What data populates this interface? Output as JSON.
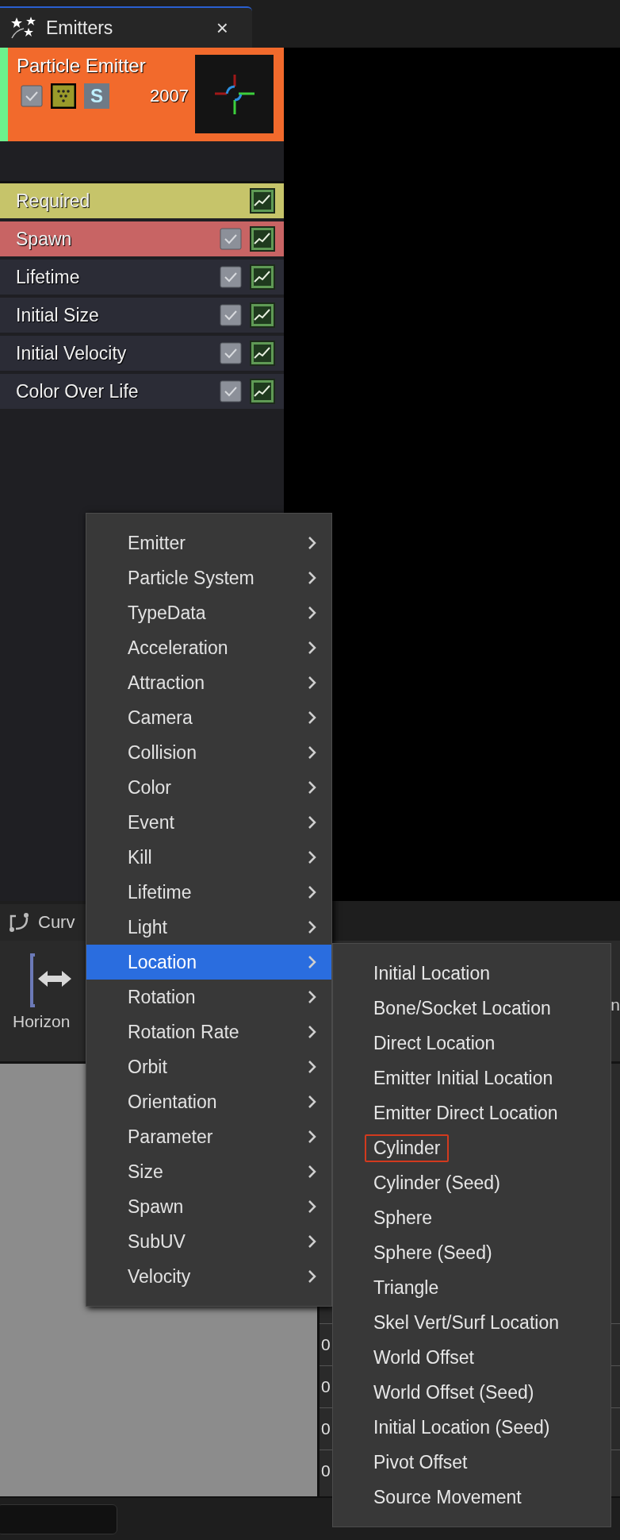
{
  "emitters_tab": {
    "title": "Emitters",
    "close": "×"
  },
  "emitter": {
    "name": "Particle Emitter",
    "enabled": true,
    "solo_label": "S",
    "count": "2007"
  },
  "modules": [
    {
      "label": "Required",
      "kind": "required",
      "color": "#c6c46a"
    },
    {
      "label": "Spawn",
      "kind": "module",
      "color": "#c86464",
      "checked": true
    },
    {
      "label": "Lifetime",
      "kind": "module",
      "color": "#2b2c36",
      "checked": true
    },
    {
      "label": "Initial Size",
      "kind": "module",
      "color": "#2b2c36",
      "checked": true
    },
    {
      "label": "Initial Velocity",
      "kind": "module",
      "color": "#2b2c36",
      "checked": true
    },
    {
      "label": "Color Over Life",
      "kind": "module",
      "color": "#2b2c36",
      "checked": true
    }
  ],
  "curve_editor": {
    "tab_label": "Curv",
    "toolbar_button": "Horizon",
    "toolbar_label_2": "n",
    "values": [
      "0",
      "0",
      "0",
      "0"
    ]
  },
  "context_menu": {
    "items": [
      {
        "label": "Emitter",
        "selected": false
      },
      {
        "label": "Particle System",
        "selected": false
      },
      {
        "label": "TypeData",
        "selected": false
      },
      {
        "label": "Acceleration",
        "selected": false
      },
      {
        "label": "Attraction",
        "selected": false
      },
      {
        "label": "Camera",
        "selected": false
      },
      {
        "label": "Collision",
        "selected": false
      },
      {
        "label": "Color",
        "selected": false
      },
      {
        "label": "Event",
        "selected": false
      },
      {
        "label": "Kill",
        "selected": false
      },
      {
        "label": "Lifetime",
        "selected": false
      },
      {
        "label": "Light",
        "selected": false
      },
      {
        "label": "Location",
        "selected": true
      },
      {
        "label": "Rotation",
        "selected": false
      },
      {
        "label": "Rotation Rate",
        "selected": false
      },
      {
        "label": "Orbit",
        "selected": false
      },
      {
        "label": "Orientation",
        "selected": false
      },
      {
        "label": "Parameter",
        "selected": false
      },
      {
        "label": "Size",
        "selected": false
      },
      {
        "label": "Spawn",
        "selected": false
      },
      {
        "label": "SubUV",
        "selected": false
      },
      {
        "label": "Velocity",
        "selected": false
      }
    ]
  },
  "submenu": {
    "items": [
      {
        "label": "Initial Location",
        "outlined": false
      },
      {
        "label": "Bone/Socket Location",
        "outlined": false
      },
      {
        "label": "Direct Location",
        "outlined": false
      },
      {
        "label": "Emitter Initial Location",
        "outlined": false
      },
      {
        "label": "Emitter Direct Location",
        "outlined": false
      },
      {
        "label": "Cylinder",
        "outlined": true
      },
      {
        "label": "Cylinder (Seed)",
        "outlined": false
      },
      {
        "label": "Sphere",
        "outlined": false
      },
      {
        "label": "Sphere (Seed)",
        "outlined": false
      },
      {
        "label": "Triangle",
        "outlined": false
      },
      {
        "label": "Skel Vert/Surf Location",
        "outlined": false
      },
      {
        "label": "World Offset",
        "outlined": false
      },
      {
        "label": "World Offset (Seed)",
        "outlined": false
      },
      {
        "label": "Initial Location (Seed)",
        "outlined": false
      },
      {
        "label": "Pivot Offset",
        "outlined": false
      },
      {
        "label": "Source Movement",
        "outlined": false
      }
    ]
  }
}
